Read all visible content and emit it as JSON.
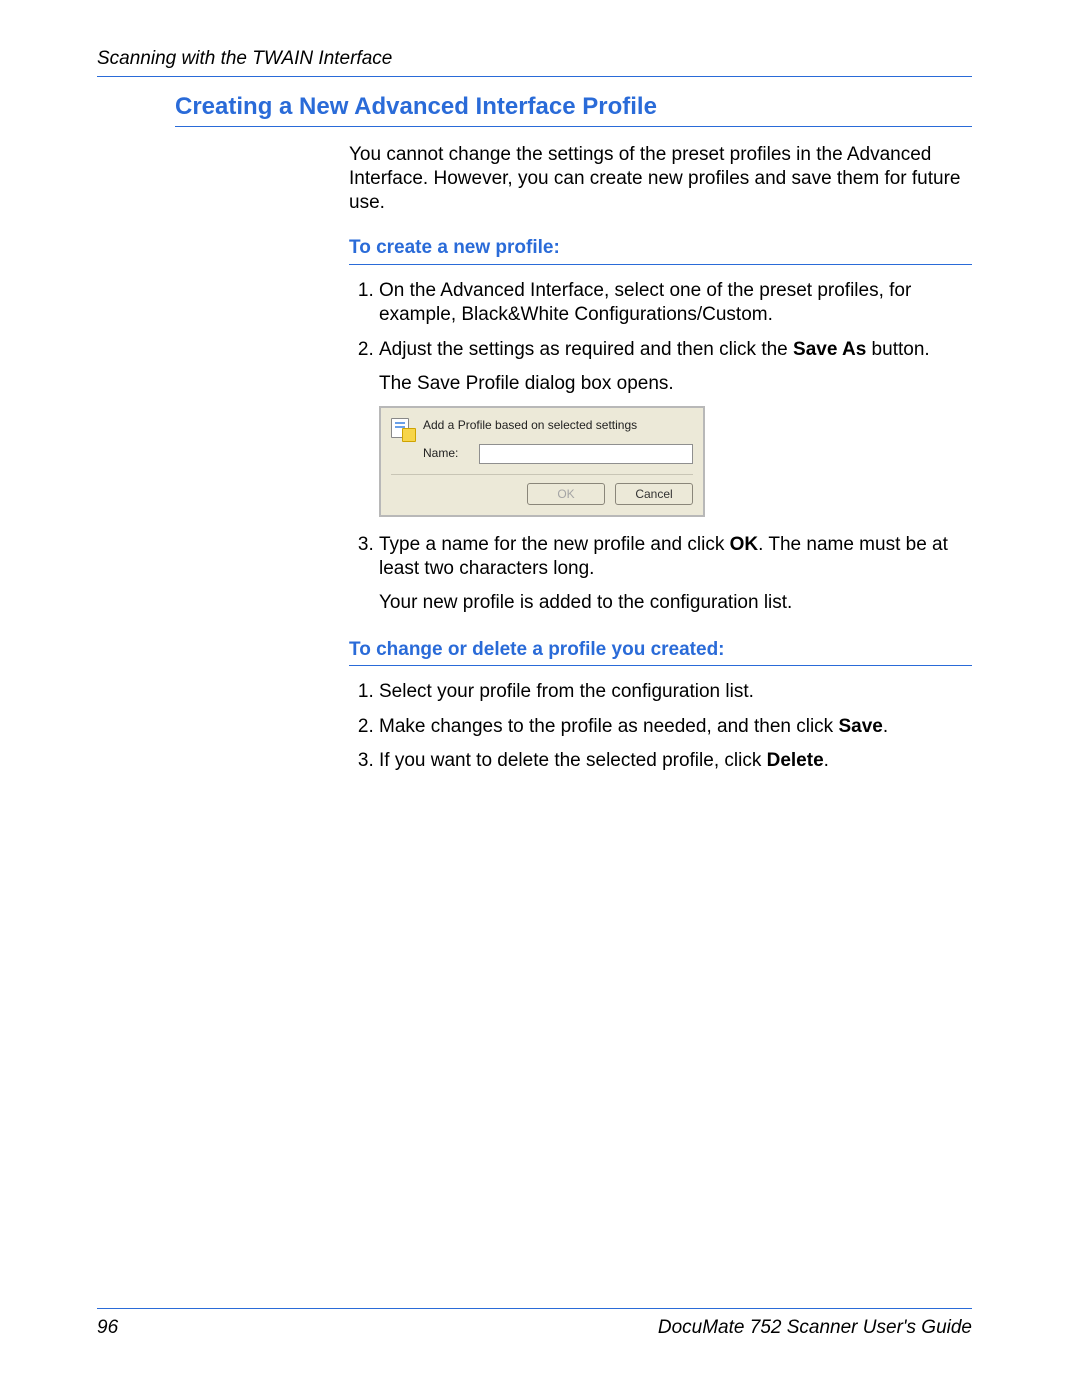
{
  "header": {
    "running": "Scanning with the TWAIN Interface"
  },
  "section_title": "Creating a New Advanced Interface Profile",
  "intro": "You cannot change the settings of the preset profiles in the Advanced Interface. However, you can create new profiles and save them for future use.",
  "sub1": {
    "heading": "To create a new profile:",
    "steps": {
      "s1": "On the Advanced Interface, select one of the preset profiles, for example, Black&White Configurations/Custom.",
      "s2a": "Adjust the settings as required and then click the ",
      "s2b": "Save As",
      "s2c": " button.",
      "s2_follow": "The Save Profile dialog box opens.",
      "s3a": "Type a name for the new profile and click ",
      "s3b": "OK",
      "s3c": ". The name must be at least two characters long.",
      "s3_follow": "Your new profile is added to the configuration list."
    }
  },
  "dialog": {
    "title": "Add a Profile based on selected settings",
    "name_label": "Name:",
    "name_value": "",
    "ok": "OK",
    "cancel": "Cancel"
  },
  "sub2": {
    "heading": "To change or delete a profile you created:",
    "steps": {
      "s1": "Select your profile from the configuration list.",
      "s2a": "Make changes to the profile as needed, and then click ",
      "s2b": "Save",
      "s2c": ".",
      "s3a": "If you want to delete the selected profile, click ",
      "s3b": "Delete",
      "s3c": "."
    }
  },
  "footer": {
    "page": "96",
    "title": "DocuMate 752 Scanner User's Guide"
  }
}
